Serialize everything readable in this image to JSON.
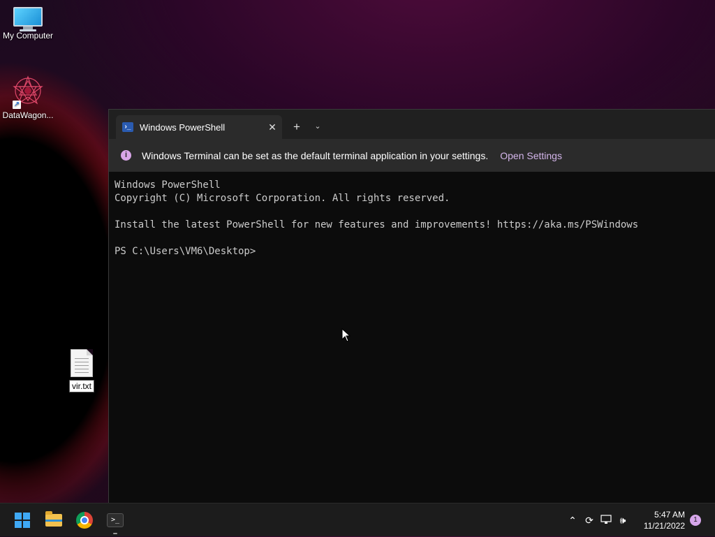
{
  "desktop": {
    "icons": [
      {
        "label": "My Computer"
      },
      {
        "label": "DataWagon..."
      },
      {
        "label": "vir.txt"
      }
    ],
    "rename_value": "vir.txt"
  },
  "terminal": {
    "tab_title": "Windows PowerShell",
    "close_glyph": "✕",
    "newtab_glyph": "+",
    "dropdown_glyph": "⌄",
    "infobar": {
      "icon": "i",
      "message": "Windows Terminal can be set as the default terminal application in your settings.",
      "link": "Open Settings"
    },
    "console_lines": [
      "Windows PowerShell",
      "Copyright (C) Microsoft Corporation. All rights reserved.",
      "",
      "Install the latest PowerShell for new features and improvements! https://aka.ms/PSWindows",
      "",
      "PS C:\\Users\\VM6\\Desktop>"
    ]
  },
  "taskbar": {
    "apps": [
      "start-icon",
      "file-explorer-icon",
      "chrome-icon",
      "terminal-icon"
    ],
    "tray_icons": [
      "chevron-up-icon",
      "sync-icon",
      "network-icon",
      "volume-icon"
    ],
    "time": "5:47 AM",
    "date": "11/21/2022",
    "notification_count": "1"
  },
  "colors": {
    "accent": "#d6a6ea",
    "terminal_bg": "#0c0c0c",
    "taskbar_bg": "#1c1c1c"
  }
}
